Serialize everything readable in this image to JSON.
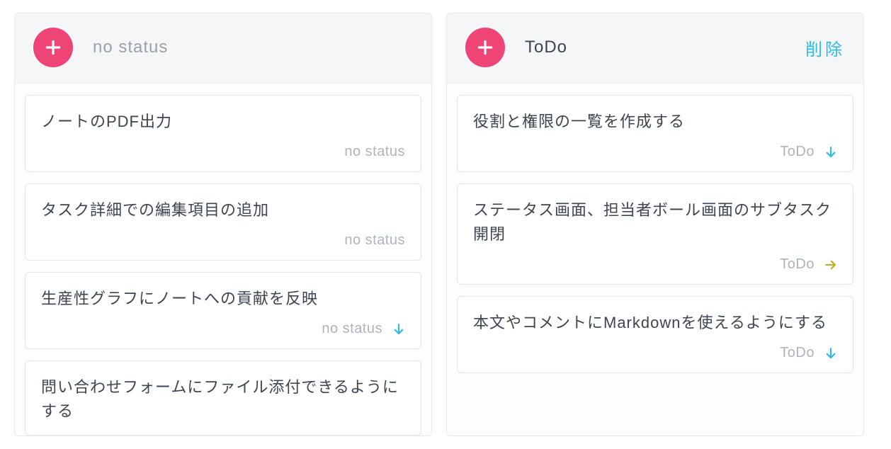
{
  "columns": [
    {
      "title": "no status",
      "titleStrong": false,
      "hasDelete": false,
      "deleteLabel": "",
      "cards": [
        {
          "title": "ノートのPDF出力",
          "status": "no status",
          "arrow": ""
        },
        {
          "title": "タスク詳細での編集項目の追加",
          "status": "no status",
          "arrow": ""
        },
        {
          "title": "生産性グラフにノートへの貢献を反映",
          "status": "no status",
          "arrow": "down-blue"
        },
        {
          "title": "問い合わせフォームにファイル添付できるようにする",
          "status": "",
          "arrow": ""
        }
      ]
    },
    {
      "title": "ToDo",
      "titleStrong": true,
      "hasDelete": true,
      "deleteLabel": "削除",
      "cards": [
        {
          "title": "役割と権限の一覧を作成する",
          "status": "ToDo",
          "arrow": "down-blue"
        },
        {
          "title": "ステータス画面、担当者ボール画面のサブタスク開閉",
          "status": "ToDo",
          "arrow": "right-olive"
        },
        {
          "title": "本文やコメントにMarkdownを使えるようにする",
          "status": "ToDo",
          "arrow": "down-blue"
        }
      ]
    }
  ]
}
